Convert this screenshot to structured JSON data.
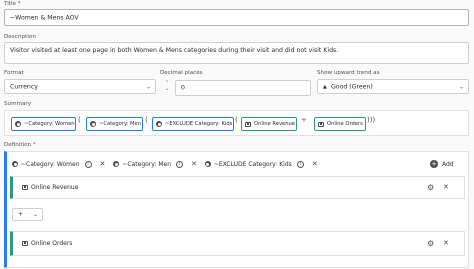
{
  "title": {
    "label": "Title",
    "value": "~Women & Mens AOV"
  },
  "description": {
    "label": "Description",
    "value": "Visitor visited at least one page in both Women & Mens categories during their visit and did not visit Kids."
  },
  "format": {
    "label": "Format",
    "value": "Currency"
  },
  "decimal_places": {
    "label": "Decimal places",
    "value": "0"
  },
  "upward_trend": {
    "label": "Show upward trend as",
    "value": "Good (Green)",
    "icon": "triangle-up-icon"
  },
  "summary": {
    "label": "Summary",
    "items": [
      {
        "type": "segment",
        "label": "~Category: Women"
      },
      {
        "type": "operator",
        "label": "("
      },
      {
        "type": "segment",
        "label": "~Category: Men"
      },
      {
        "type": "operator",
        "label": "("
      },
      {
        "type": "segment",
        "label": "~EXCLUDE Category: Kids"
      },
      {
        "type": "operator",
        "label": "("
      },
      {
        "type": "metric",
        "label": "Online Revenue"
      },
      {
        "type": "operator",
        "label": "÷"
      },
      {
        "type": "metric",
        "label": "Online Orders"
      },
      {
        "type": "operator",
        "label": ")))"
      }
    ]
  },
  "definition": {
    "label": "Definition",
    "add_label": "Add",
    "segments": [
      "~Category: Women",
      "~Category: Men",
      "~EXCLUDE Category: Kids"
    ],
    "metrics": [
      "Online Revenue",
      "Online Orders"
    ],
    "operator": "+"
  },
  "colors": {
    "metric": "#2d9d78",
    "segment": "#2680eb",
    "required_marker": "#505050"
  }
}
